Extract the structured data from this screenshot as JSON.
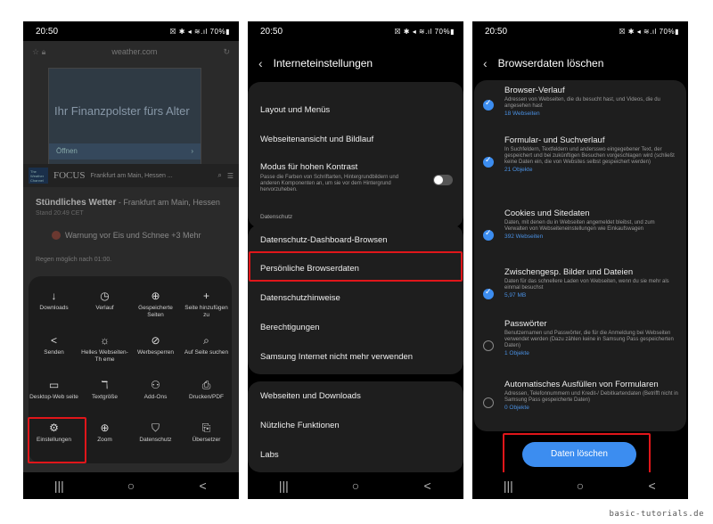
{
  "phone1": {
    "time": "20:50",
    "status_icons": "☒ ✱ ◂ ≋.ıl 70%▮",
    "url": "weather.com",
    "ad_text": "Ihr Finanzpolster fürs Alter",
    "ad_button": "Öffnen",
    "logo1": "The Weather Channel",
    "logo2": "FOCUS",
    "location": "Frankfurt am Main, Hessen ...",
    "weather_title": "Stündliches Wetter",
    "weather_sub": " - Frankfurt am Main, Hessen",
    "stand": "Stand 20:49 CET",
    "warning": "Warnung vor Eis und Schnee +3 Mehr",
    "rain": "Regen möglich nach 01:00.",
    "menu_items": [
      {
        "icon": "↓",
        "label": "Downloads"
      },
      {
        "icon": "◷",
        "label": "Verlauf"
      },
      {
        "icon": "⊕",
        "label": "Gespeicherte Seiten"
      },
      {
        "icon": "+",
        "label": "Seite hinzufügen zu"
      },
      {
        "icon": "<",
        "label": "Senden"
      },
      {
        "icon": "☼",
        "label": "Helles Webseiten-Th eme"
      },
      {
        "icon": "⊘",
        "label": "Werbesperren"
      },
      {
        "icon": "⌕",
        "label": "Auf Seite suchen"
      },
      {
        "icon": "▭",
        "label": "Desktop-Web seite"
      },
      {
        "icon": "ℸ",
        "label": "Textgröße"
      },
      {
        "icon": "⚇",
        "label": "Add-Ons"
      },
      {
        "icon": "⎙",
        "label": "Drucken/PDF"
      },
      {
        "icon": "⚙",
        "label": "Einstellungen"
      },
      {
        "icon": "⊕",
        "label": "Zoom"
      },
      {
        "icon": "⛉",
        "label": "Datenschutz"
      },
      {
        "icon": "⎘",
        "label": "Übersetzer"
      }
    ]
  },
  "phone2": {
    "time": "20:50",
    "title": "Interneteinstellungen",
    "items_a": [
      {
        "label": "Layout und Menüs"
      },
      {
        "label": "Webseitenansicht und Bildlauf"
      }
    ],
    "contrast_label": "Modus für hohen Kontrast",
    "contrast_sub": "Passe die Farben von Schriftarten, Hintergrundbildern und anderen Komponenten an, um sie vor dem Hintergrund hervorzuheben.",
    "section_privacy": "Datenschutz",
    "items_b": [
      {
        "label": "Datenschutz-Dashboard-Browsen"
      },
      {
        "label": "Persönliche Browserdaten"
      },
      {
        "label": "Datenschutzhinweise"
      },
      {
        "label": "Berechtigungen"
      },
      {
        "label": "Samsung Internet nicht mehr verwenden"
      }
    ],
    "items_c": [
      {
        "label": "Webseiten und Downloads"
      },
      {
        "label": "Nützliche Funktionen"
      },
      {
        "label": "Labs"
      }
    ]
  },
  "phone3": {
    "time": "20:50",
    "title": "Browserdaten löschen",
    "entries": [
      {
        "title": "Browser-Verlauf",
        "desc": "Adressen von Webseiten, die du besucht hast, und Videos, die du angesehen hast",
        "count": "18 Webseiten",
        "checked": true
      },
      {
        "title": "Formular- und Suchverlauf",
        "desc": "In Suchfeldern, Textfeldern und andersswo eingegebener Text, der gespeichert und bei zukünftigen Besuchen vorgeschlagen wird (schließt keine Daten ein, die von Websites selbst gespeichert werden)",
        "count": "21 Objekte",
        "checked": true
      },
      {
        "title": "Cookies und Sitedaten",
        "desc": "Daten, mit denen du in Webseiten angemeldet bleibst, und zum Verwalten von Webseiteneinstellungen wie Einkaufswagen",
        "count": "392 Webseiten",
        "checked": true
      },
      {
        "title": "Zwischengesp. Bilder und Dateien",
        "desc": "Daten für das schnellere Laden von Webseiten, wenn du sie mehr als einmal besuchst",
        "count": "5,97 MB",
        "checked": true
      },
      {
        "title": "Passwörter",
        "desc": "Benutzernamen und Passwörter, die für die Anmeldung bei Webseiten verwendet werden (Dazu zählen keine in Samsung Pass gespeicherten Daten)",
        "count": "1 Objekte",
        "checked": false
      },
      {
        "title": "Automatisches Ausfüllen von Formularen",
        "desc": "Adressen, Telefonnummern und Kredit-/ Debitkartendaten (Betrifft nicht in Samsung Pass gespeicherte Daten)",
        "count": "0 Objekte",
        "checked": false
      }
    ],
    "delete_button": "Daten löschen"
  },
  "nav_icons": [
    "|||",
    "○",
    "<"
  ],
  "watermark": "basic-tutorials.de",
  "colors": {
    "accent": "#3c8df0",
    "highlight": "#e0161a",
    "card": "#1e1e1e"
  }
}
